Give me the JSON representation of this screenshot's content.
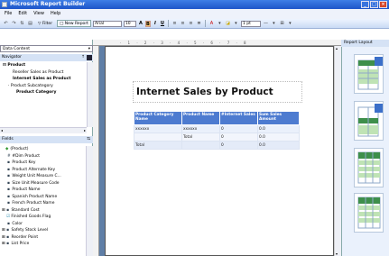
{
  "window": {
    "title": "Microsoft Report Builder"
  },
  "menu": [
    "File",
    "Edit",
    "View",
    "Help"
  ],
  "toolbar": {
    "filter_label": "Filter",
    "new_report_label": "New Report",
    "font_name": "Arial",
    "font_size": "10",
    "bold": "B",
    "italic": "I",
    "underline": "U",
    "border_width": "1 pt"
  },
  "left_panel": {
    "data_source_label": "Data Content",
    "navigator_label": "Navigator",
    "navigator_items": [
      "Product",
      "Reseller Sales as Product",
      "Internet Sales as Product",
      "Product Subcategory",
      "Product Category"
    ],
    "fields_label": "Fields",
    "fields": [
      {
        "icon": "entity-icon",
        "label": "(Product)"
      },
      {
        "icon": "count-icon",
        "label": "#Dim Product"
      },
      {
        "icon": "attribute-icon",
        "label": "Product Key"
      },
      {
        "icon": "attribute-icon",
        "label": "Product Alternate Key"
      },
      {
        "icon": "attribute-icon",
        "label": "Weight Unit Measure C..."
      },
      {
        "icon": "attribute-icon",
        "label": "Size Unit Measure Code"
      },
      {
        "icon": "attribute-icon",
        "label": "Product Name"
      },
      {
        "icon": "attribute-icon",
        "label": "Spanish Product Name"
      },
      {
        "icon": "attribute-icon",
        "label": "French Product Name"
      },
      {
        "icon": "expand-icon",
        "label": "Standard Cost"
      },
      {
        "icon": "checkbox-icon",
        "label": "Finished Goods Flag"
      },
      {
        "icon": "attribute-icon",
        "label": "Color"
      },
      {
        "icon": "expand-icon",
        "label": "Safety Stock Level"
      },
      {
        "icon": "expand-icon",
        "label": "Reorder Point"
      },
      {
        "icon": "expand-icon",
        "label": "List Price"
      }
    ]
  },
  "report": {
    "title": "Internet Sales by Product",
    "columns": [
      "Product Category Name",
      "Product Name",
      "#Internet Sales",
      "Sum Sales Amount"
    ],
    "rows": [
      [
        "xxxxxx",
        "xxxxxx",
        "0",
        "0.0"
      ],
      [
        "",
        "Total",
        "0",
        "0.0"
      ],
      [
        "Total",
        "",
        "0",
        "0.0"
      ]
    ]
  },
  "right_panel": {
    "label": "Report Layout"
  },
  "ruler_ticks": "·  1  ·  2  ·  3  ·  4  ·  5  ·  6  ·  7  ·  8"
}
